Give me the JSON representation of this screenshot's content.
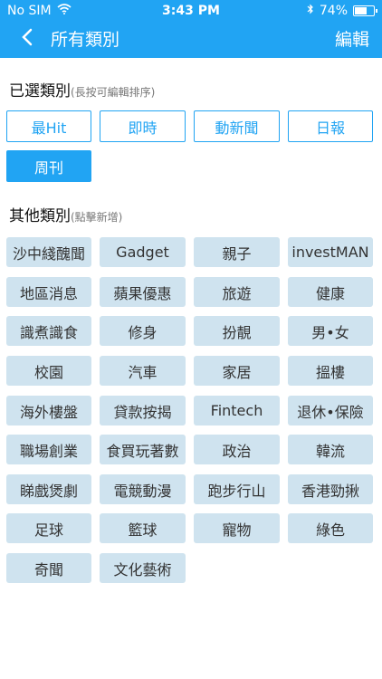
{
  "status": {
    "carrier": "No SIM",
    "time": "3:43 PM",
    "battery": "74%",
    "battery_level": 0.74
  },
  "nav": {
    "back_icon": "chevron-left",
    "title": "所有類別",
    "edit_label": "編輯"
  },
  "selected": {
    "title": "已選類別",
    "hint": "(長按可編輯排序)",
    "items": [
      "最Hit",
      "即時",
      "動新聞",
      "日報",
      "周刊"
    ]
  },
  "other": {
    "title": "其他類別",
    "hint": "(點擊新增)",
    "items": [
      "沙中綫醜聞",
      "Gadget",
      "親子",
      "investMAN",
      "地區消息",
      "蘋果優惠",
      "旅遊",
      "健康",
      "識煮識食",
      "修身",
      "扮靚",
      "男•女",
      "校園",
      "汽車",
      "家居",
      "搵樓",
      "海外樓盤",
      "貸款按揭",
      "Fintech",
      "退休•保險",
      "職場創業",
      "食買玩著數",
      "政治",
      "韓流",
      "睇戲煲劇",
      "電競動漫",
      "跑步行山",
      "香港勁揪",
      "足球",
      "籃球",
      "寵物",
      "綠色",
      "奇聞",
      "文化藝術"
    ]
  }
}
